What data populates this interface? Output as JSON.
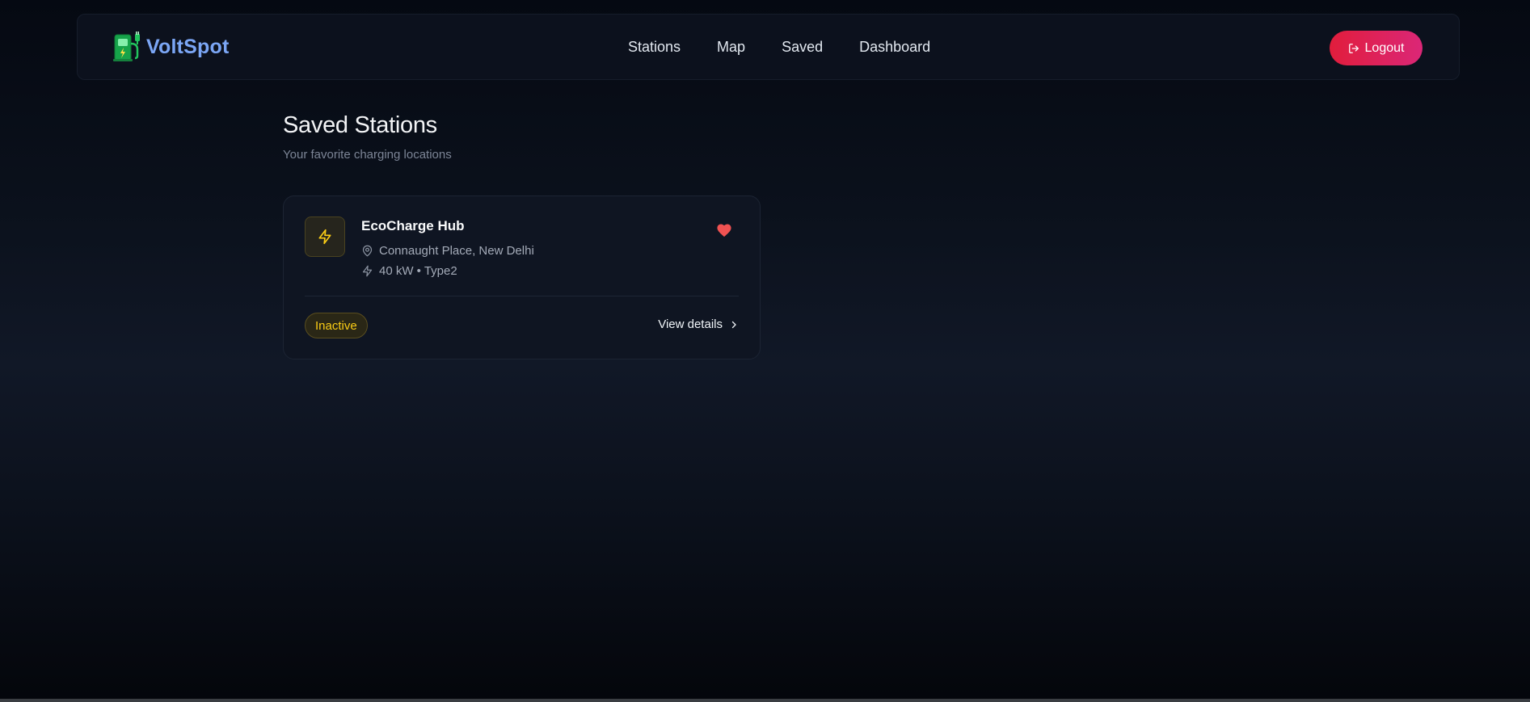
{
  "brand": {
    "name": "VoltSpot",
    "icon": "ev-charger-icon"
  },
  "nav": {
    "links": [
      {
        "label": "Stations"
      },
      {
        "label": "Map"
      },
      {
        "label": "Saved"
      },
      {
        "label": "Dashboard"
      }
    ],
    "logout_label": "Logout",
    "logout_icon": "logout-icon"
  },
  "page": {
    "title": "Saved Stations",
    "subtitle": "Your favorite charging locations"
  },
  "stations": [
    {
      "name": "EcoCharge Hub",
      "location": "Connaught Place, New Delhi",
      "spec": "40 kW • Type2",
      "status": "Inactive",
      "saved": true,
      "action_label": "View details",
      "icons": [
        "lightning-icon",
        "map-pin-icon",
        "heart-icon",
        "chevron-right-icon"
      ]
    }
  ],
  "colors": {
    "brand": "#7ba6f5",
    "logout_gradient_start": "#e11d3c",
    "logout_gradient_end": "#db2777",
    "status_inactive": "#facc15",
    "heart": "#f05252",
    "background": "#0b111c"
  }
}
